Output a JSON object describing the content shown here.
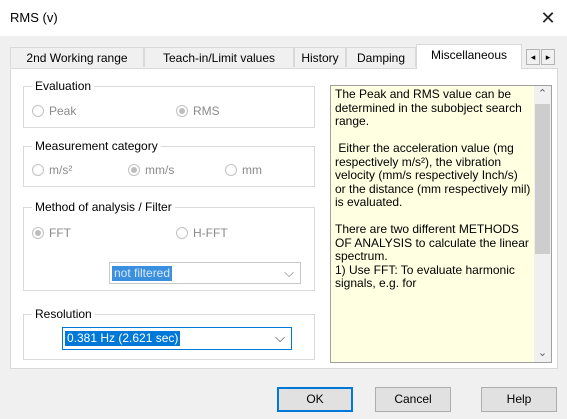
{
  "window": {
    "title": "RMS (v)",
    "close_glyph": "✕"
  },
  "tabs": [
    {
      "label": "2nd Working range"
    },
    {
      "label": "Teach-in/Limit values"
    },
    {
      "label": "History"
    },
    {
      "label": "Damping"
    },
    {
      "label": "Miscellaneous",
      "active": true
    }
  ],
  "tab_scroll": {
    "left_icon": "◂",
    "right_icon": "▸"
  },
  "evaluation": {
    "title": "Evaluation",
    "options": [
      {
        "label": "Peak",
        "selected": false
      },
      {
        "label": "RMS",
        "selected": true
      }
    ]
  },
  "measurement": {
    "title": "Measurement category",
    "options": [
      {
        "label": "m/s²",
        "selected": false
      },
      {
        "label": "mm/s",
        "selected": true
      },
      {
        "label": "mm",
        "selected": false
      }
    ]
  },
  "method": {
    "title": "Method of analysis / Filter",
    "options": [
      {
        "label": "FFT",
        "selected": true
      },
      {
        "label": "H-FFT",
        "selected": false
      }
    ],
    "filter_value": "not filtered"
  },
  "resolution": {
    "title": "Resolution",
    "value": "0.381 Hz (2.621 sec)"
  },
  "help_text": "The Peak and RMS value can be determined in the subobject search range.\n\n Either the acceleration value (mg respectively m/s²), the vibration velocity (mm/s respectively Inch/s) or the distance (mm respectively mil) is evaluated.\n\nThere are two different METHODS OF ANALYSIS to calculate the linear spectrum.\n1) Use FFT: To evaluate harmonic signals, e.g. for",
  "chevron_glyph": "⌵",
  "scroll_glyphs": {
    "up": "⌃",
    "down": "⌄"
  },
  "buttons": {
    "ok": "OK",
    "cancel": "Cancel",
    "help": "Help"
  },
  "colors": {
    "selection": "#0078d7",
    "help_bg": "#ffffe1"
  }
}
